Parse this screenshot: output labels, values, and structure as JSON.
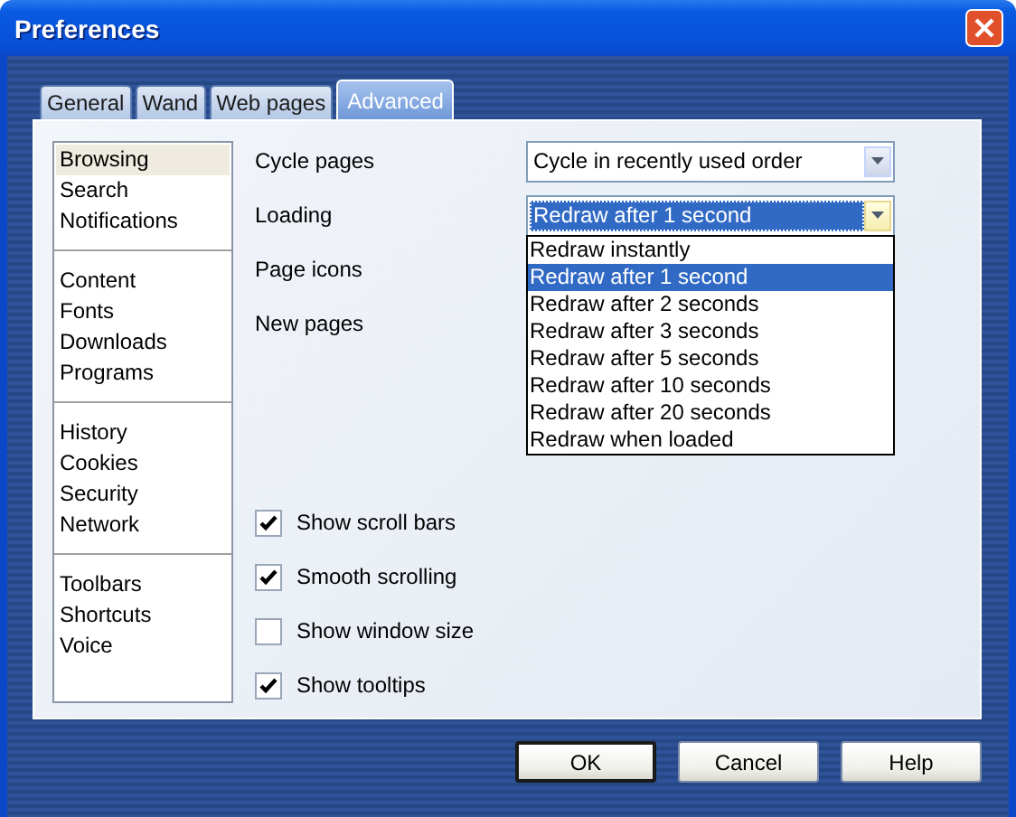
{
  "window": {
    "title": "Preferences"
  },
  "tabs": [
    {
      "label": "General",
      "selected": false
    },
    {
      "label": "Wand",
      "selected": false
    },
    {
      "label": "Web pages",
      "selected": false
    },
    {
      "label": "Advanced",
      "selected": true
    }
  ],
  "sidebar": {
    "groups": [
      {
        "items": [
          {
            "label": "Browsing",
            "selected": true
          },
          {
            "label": "Search",
            "selected": false
          },
          {
            "label": "Notifications",
            "selected": false
          }
        ]
      },
      {
        "items": [
          {
            "label": "Content",
            "selected": false
          },
          {
            "label": "Fonts",
            "selected": false
          },
          {
            "label": "Downloads",
            "selected": false
          },
          {
            "label": "Programs",
            "selected": false
          }
        ]
      },
      {
        "items": [
          {
            "label": "History",
            "selected": false
          },
          {
            "label": "Cookies",
            "selected": false
          },
          {
            "label": "Security",
            "selected": false
          },
          {
            "label": "Network",
            "selected": false
          }
        ]
      },
      {
        "items": [
          {
            "label": "Toolbars",
            "selected": false
          },
          {
            "label": "Shortcuts",
            "selected": false
          },
          {
            "label": "Voice",
            "selected": false
          }
        ]
      }
    ]
  },
  "settings": [
    {
      "label": "Cycle pages",
      "value": "Cycle in recently used order",
      "focused": false
    },
    {
      "label": "Loading",
      "value": "Redraw after 1 second",
      "focused": true,
      "options": [
        {
          "label": "Redraw instantly",
          "selected": false
        },
        {
          "label": "Redraw after 1 second",
          "selected": true
        },
        {
          "label": "Redraw after 2 seconds",
          "selected": false
        },
        {
          "label": "Redraw after 3 seconds",
          "selected": false
        },
        {
          "label": "Redraw after 5 seconds",
          "selected": false
        },
        {
          "label": "Redraw after 10 seconds",
          "selected": false
        },
        {
          "label": "Redraw after 20 seconds",
          "selected": false
        },
        {
          "label": "Redraw when loaded",
          "selected": false
        }
      ]
    },
    {
      "label": "Page icons"
    },
    {
      "label": "New pages"
    }
  ],
  "checkboxes": [
    {
      "label": "Show scroll bars",
      "checked": true
    },
    {
      "label": "Smooth scrolling",
      "checked": true
    },
    {
      "label": "Show window size",
      "checked": false
    },
    {
      "label": "Show tooltips",
      "checked": true
    }
  ],
  "buttons": [
    {
      "label": "OK",
      "default": true
    },
    {
      "label": "Cancel",
      "default": false
    },
    {
      "label": "Help",
      "default": false
    }
  ]
}
